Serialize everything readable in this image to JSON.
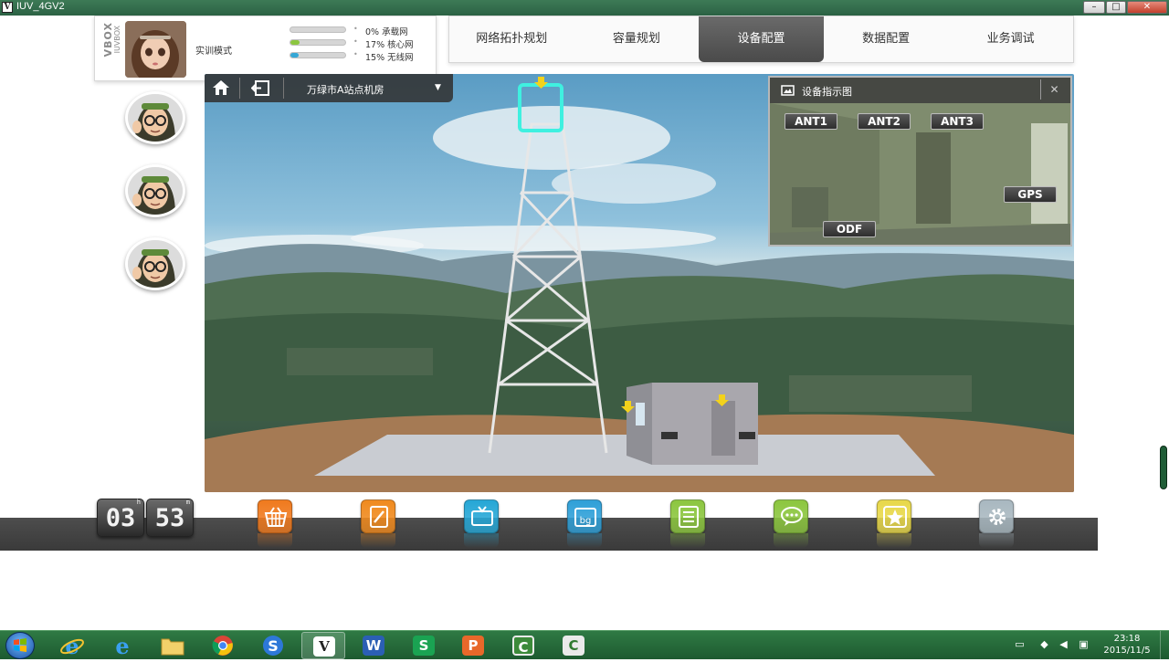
{
  "window": {
    "title": "IUV_4GV2",
    "app_icon": "V",
    "minimize": "–",
    "maximize": "□",
    "close": "✕"
  },
  "profile": {
    "brand": "VBOX",
    "brand_sub": "IUVBOX",
    "mode": "实训模式",
    "progress": [
      {
        "pct": 0,
        "label": "0% 承载网",
        "color": "#8a8a8a"
      },
      {
        "pct": 17,
        "label": "17% 核心网",
        "color": "#8cc63f"
      },
      {
        "pct": 15,
        "label": "15% 无线网",
        "color": "#35a7d6"
      }
    ],
    "bullet": "•"
  },
  "nav": {
    "tabs": [
      {
        "label": "网络拓扑规划",
        "active": false
      },
      {
        "label": "容量规划",
        "active": false
      },
      {
        "label": "设备配置",
        "active": true
      },
      {
        "label": "数据配置",
        "active": false
      },
      {
        "label": "业务调试",
        "active": false
      }
    ]
  },
  "scene": {
    "location": "万绿市A站点机房",
    "dropdown_arrow": "▼"
  },
  "diagram": {
    "title": "设备指示图",
    "close": "✕",
    "ports": [
      "ANT1",
      "ANT2",
      "ANT3",
      "GPS",
      "ODF"
    ]
  },
  "timer": {
    "hours": "03",
    "minutes": "53",
    "h_unit": "h",
    "m_unit": "m"
  },
  "toolbar": {
    "tools": [
      {
        "name": "shop",
        "color": "#f07a1e"
      },
      {
        "name": "notes",
        "color": "#f08a1e"
      },
      {
        "name": "tv",
        "color": "#26a7d6"
      },
      {
        "name": "bg",
        "color": "#2fa0d8"
      },
      {
        "name": "list",
        "color": "#8cc63f"
      },
      {
        "name": "chat",
        "color": "#8cc63f"
      },
      {
        "name": "favorite",
        "color": "#e8d84a"
      },
      {
        "name": "settings",
        "color": "#a9b8c0"
      }
    ],
    "bg_label": "bg"
  },
  "taskbar": {
    "apps": [
      "ie",
      "ie2",
      "folder",
      "chrome",
      "sogou",
      "vbox",
      "word",
      "wps-s",
      "wps-p",
      "camtasia",
      "camtasia2"
    ],
    "glyphs": {
      "vbox": "V",
      "word": "W",
      "wps-s": "S",
      "wps-p": "P",
      "camtasia": "C",
      "camtasia2": "C"
    },
    "clock_time": "23:18",
    "clock_date": "2015/11/5"
  }
}
